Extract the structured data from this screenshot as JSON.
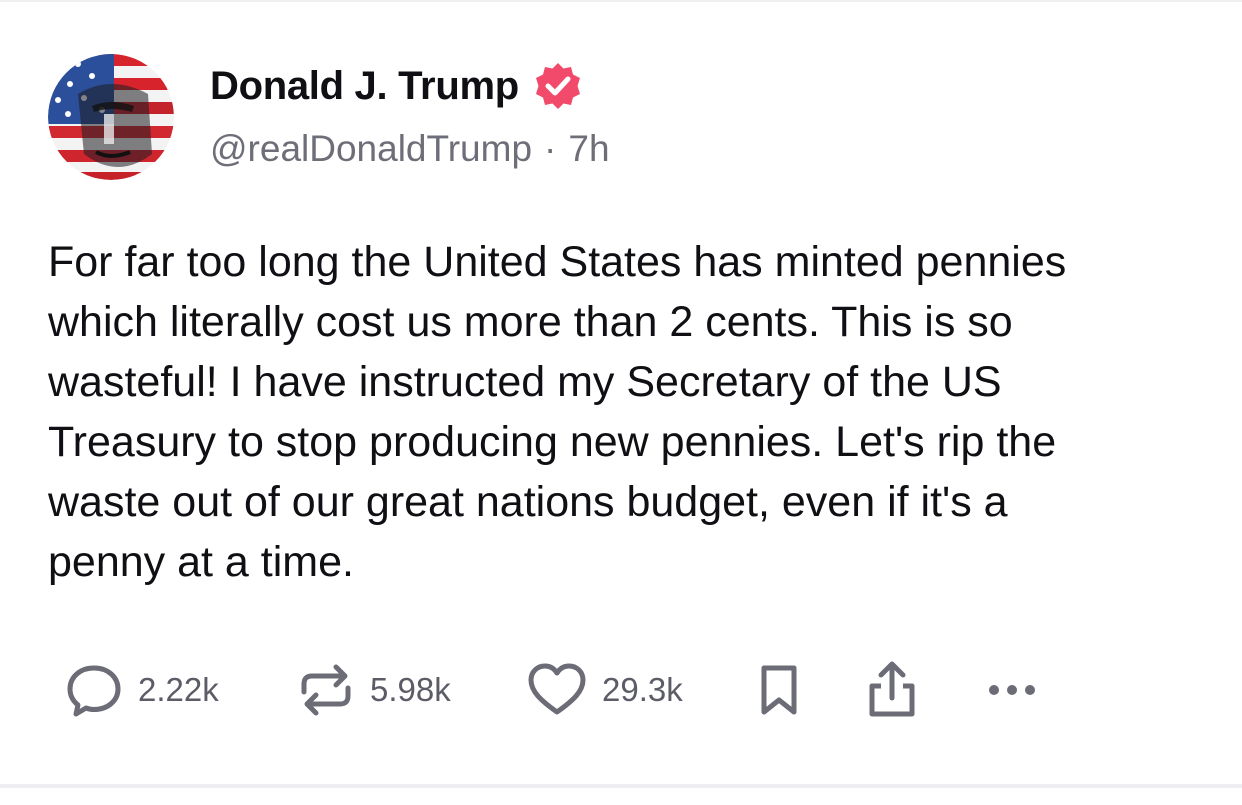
{
  "post": {
    "author": {
      "display_name": "Donald J. Trump",
      "handle": "@realDonaldTrump",
      "verified_icon": "verified-badge-icon",
      "verified_color": "#f24a6b"
    },
    "separator": "·",
    "time_ago": "7h",
    "text": "For far too long the United States has minted pennies\nwhich literally cost us more than 2 cents. This is so\nwasteful! I have instructed my Secretary of the US\nTreasury to stop producing new pennies. Let's rip the\nwaste out of our great nations budget, even if it's a\npenny at a time.",
    "actions": {
      "reply": {
        "icon": "reply-icon",
        "count": "2.22k"
      },
      "repost": {
        "icon": "repost-icon",
        "count": "5.98k"
      },
      "like": {
        "icon": "heart-icon",
        "count": "29.3k"
      },
      "bookmark": {
        "icon": "bookmark-icon"
      },
      "share": {
        "icon": "share-icon"
      },
      "more": {
        "icon": "more-icon"
      }
    }
  },
  "colors": {
    "text": "#0f0f14",
    "muted": "#6d6e78",
    "icon": "#6b6c76",
    "divider": "#eeeef1"
  }
}
